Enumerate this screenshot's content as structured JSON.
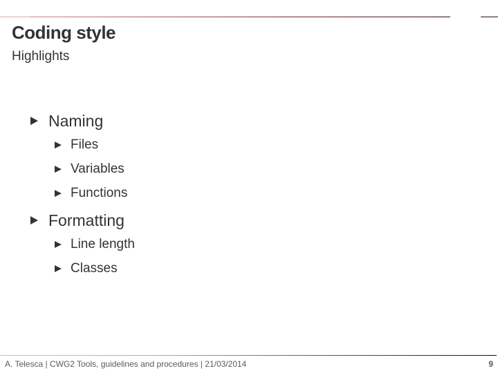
{
  "slide": {
    "title": "Coding style",
    "subtitle": "Highlights",
    "accent_color": "#9a4a4a",
    "text_color": "#333333"
  },
  "bullets": [
    {
      "label": "Naming",
      "level": 1,
      "icon": "triangle-right-bullet-icon",
      "children": [
        {
          "label": "Files",
          "level": 2,
          "icon": "triangle-right-bullet-icon"
        },
        {
          "label": "Variables",
          "level": 2,
          "icon": "triangle-right-bullet-icon"
        },
        {
          "label": "Functions",
          "level": 2,
          "icon": "triangle-right-bullet-icon"
        }
      ]
    },
    {
      "label": "Formatting",
      "level": 1,
      "icon": "triangle-right-bullet-icon",
      "children": [
        {
          "label": "Line length",
          "level": 2,
          "icon": "triangle-right-bullet-icon"
        },
        {
          "label": "Classes",
          "level": 2,
          "icon": "triangle-right-bullet-icon"
        }
      ]
    }
  ],
  "footer": {
    "text": "A. Telesca | CWG2 Tools, guidelines and procedures | 21/03/2014",
    "page_number": "9"
  }
}
